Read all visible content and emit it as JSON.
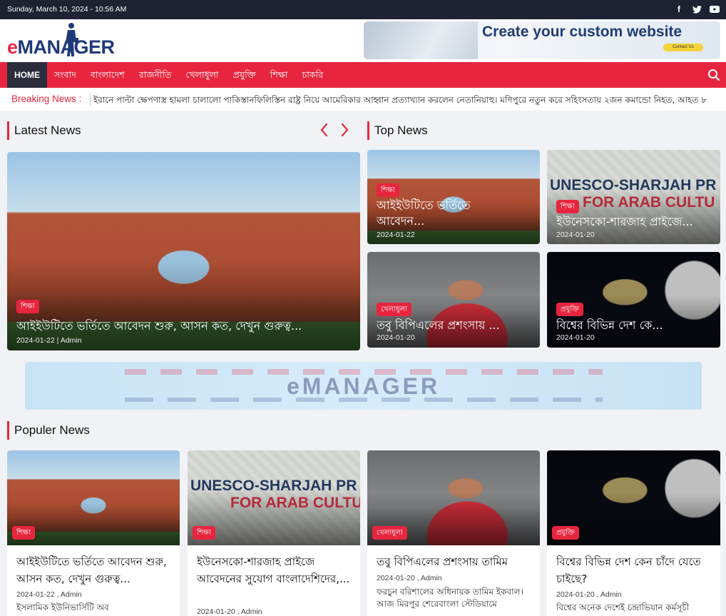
{
  "topbar": {
    "date": "Sunday, March 10, 2024 - 10:56 AM",
    "social": [
      "f",
      "t",
      "y"
    ]
  },
  "logo": {
    "e": "e",
    "rest": "MANAGER"
  },
  "ad_top": {
    "headline": "Create your custom website",
    "cta": "Contact Us"
  },
  "nav": {
    "items": [
      "HOME",
      "সংবাদ",
      "বাংলাদেশ",
      "রাজনীতি",
      "খেলাধুলা",
      "প্রযুক্তি",
      "শিক্ষা",
      "চাকরি"
    ]
  },
  "breaking": {
    "label": "Breaking News :",
    "ticker": "ইরানে পাল্টা ক্ষেপণাস্ত্র হামলা চালালো পাকিস্তানফিলিস্তিন রাষ্ট্র নিয়ে আমেরিকার আহ্বান প্রত্যাখ্যান করলেন নেতানিয়াহু।  মণিপুরে নতুন করে সহিংসতায় ২জন কমান্ডো নিহত, আহত ৮"
  },
  "latest": {
    "heading": "Latest News",
    "featured": {
      "category": "শিক্ষা",
      "title": "আইইউটিতে ভর্তিতে আবেদন শুরু, আসন কত, দেখুন গুরুত্ব...",
      "meta": "2024-01-22 | Admin"
    }
  },
  "top": {
    "heading": "Top News",
    "items": [
      {
        "category": "শিক্ষা",
        "title": "আইইউটিতে ভর্তিতে আবেদন...",
        "date": "2024-01-22"
      },
      {
        "category": "শিক্ষা",
        "title": "ইউনেসকো-শারজাহ প্রাইজে...",
        "date": "2024-01-20",
        "img_text_1": "UNESCO-SHARJAH PR",
        "img_text_2": "FOR ARAB CULTU"
      },
      {
        "category": "খেলাধুলা",
        "title": "তবু বিপিএলের প্রশংসায় ...",
        "date": "2024-01-20"
      },
      {
        "category": "প্রযুক্তি",
        "title": "বিশ্বের বিভিন্ন দেশ কে...",
        "date": "2024-01-20"
      }
    ]
  },
  "mid_banner": {
    "brand": "eMANAGER"
  },
  "popular": {
    "heading": "Populer News",
    "items": [
      {
        "category": "শিক্ষা",
        "title": "আইইউটিতে ভর্তিতে আবেদন শুরু, আসন কত, দেখুন গুরুত্ব...",
        "meta": "2024-01-22 , Admin",
        "excerpt": "ইসলামিক ইউনিভার্সিটি অব"
      },
      {
        "category": "শিক্ষা",
        "title": "ইউনেসকো-শারজাহ প্রাইজে আবেদনের সুযোগ বাংলাদেশিদের,...",
        "meta": "2024-01-20 , Admin",
        "excerpt": "",
        "img_text_1": "UNESCO-SHARJAH PR",
        "img_text_2": "FOR ARAB CULTU"
      },
      {
        "category": "খেলাধুলা",
        "title": "তবু বিপিএলের প্রশংসায় তামিম",
        "meta": "2024-01-20 , Admin",
        "excerpt": "ফরচুন বরিশালের অধিনায়ক তামিম ইকবাল। আজ মিরপুর শেরেবাংলা স্টেডিয়ামে"
      },
      {
        "category": "প্রযুক্তি",
        "title": "বিশ্বের বিভিন্ন দেশ কেন চাঁদে যেতে চাইছে?",
        "meta": "2024-01-20 , Admin",
        "excerpt": "বিশ্বের অনেক দেশেই চন্দ্রাভিযান কর্মসূচী"
      }
    ]
  }
}
